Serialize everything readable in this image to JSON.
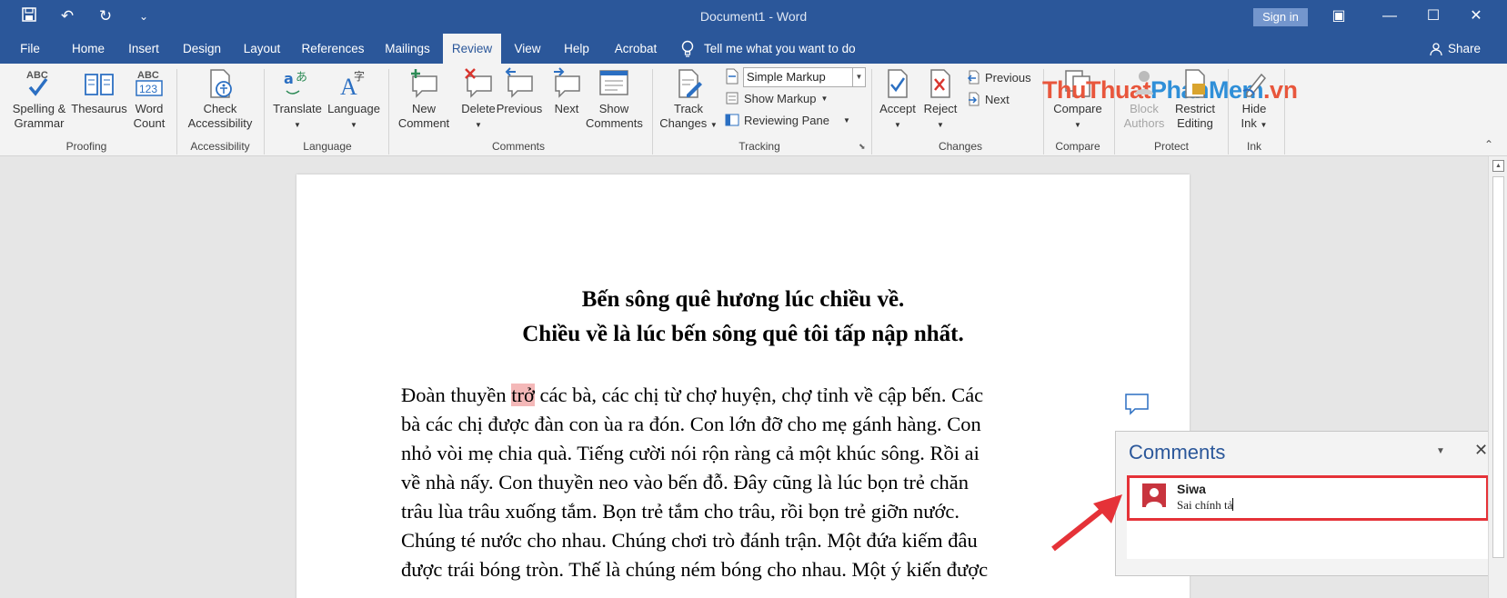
{
  "window": {
    "title": "Document1  -  Word",
    "sign_in": "Sign in",
    "restore_ribbon": "▣",
    "minimize": "—",
    "maximize": "☐",
    "close": "✕"
  },
  "qat": {
    "save": "💾",
    "undo": "↶",
    "redo": "↻",
    "customize": "⌄"
  },
  "tabs": [
    {
      "label": "File"
    },
    {
      "label": "Home"
    },
    {
      "label": "Insert"
    },
    {
      "label": "Design"
    },
    {
      "label": "Layout"
    },
    {
      "label": "References"
    },
    {
      "label": "Mailings"
    },
    {
      "label": "Review"
    },
    {
      "label": "View"
    },
    {
      "label": "Help"
    },
    {
      "label": "Acrobat"
    }
  ],
  "tell_me": "Tell me what you want to do",
  "share": "Share",
  "ribbon": {
    "proofing": {
      "spelling": [
        "Spelling &",
        "Grammar"
      ],
      "thesaurus": "Thesaurus",
      "word_count": [
        "Word",
        "Count"
      ],
      "label": "Proofing"
    },
    "accessibility": {
      "check": [
        "Check",
        "Accessibility"
      ],
      "label": "Accessibility"
    },
    "language": {
      "translate": "Translate",
      "language": "Language",
      "label": "Language"
    },
    "comments": {
      "new": [
        "New",
        "Comment"
      ],
      "delete": "Delete",
      "previous": "Previous",
      "next": "Next",
      "show": [
        "Show",
        "Comments"
      ],
      "label": "Comments"
    },
    "tracking": {
      "track_changes": [
        "Track",
        "Changes"
      ],
      "markup_select": "Simple Markup",
      "show_markup": "Show Markup",
      "reviewing_pane": "Reviewing Pane",
      "label": "Tracking"
    },
    "changes": {
      "accept": "Accept",
      "reject": "Reject",
      "previous": "Previous",
      "next": "Next",
      "label": "Changes"
    },
    "compare": {
      "compare": "Compare",
      "label": "Compare"
    },
    "protect": {
      "block_authors": [
        "Block",
        "Authors"
      ],
      "restrict_editing": [
        "Restrict",
        "Editing"
      ],
      "label": "Protect"
    },
    "ink": {
      "hide_ink": [
        "Hide",
        "Ink"
      ],
      "label": "Ink"
    },
    "watermark": {
      "part1": "ThuThuat",
      "part2": "PhanMem",
      "part3": ".vn"
    }
  },
  "document": {
    "heading1": "Bến sông quê hương lúc chiều về.",
    "heading2": "Chiều về là lúc bến sông quê tôi tấp nập nhất.",
    "lines": [
      {
        "before": "Đoàn thuyền ",
        "highlight": "trở",
        "after": " các bà, các chị từ chợ huyện, chợ tỉnh về cập bến. Các"
      },
      {
        "text": "bà các chị được đàn con ùa ra đón. Con lớn đỡ cho mẹ gánh hàng. Con"
      },
      {
        "text": "nhỏ vòi mẹ chia quà. Tiếng cười nói rộn ràng cả một khúc sông. Rồi ai"
      },
      {
        "text": "về nhà nấy. Con thuyền neo vào bến đỗ. Đây cũng là lúc bọn trẻ chăn"
      },
      {
        "text": "trâu lùa trâu xuống tắm. Bọn trẻ tắm cho trâu, rồi bọn trẻ giỡn nước."
      },
      {
        "text": "Chúng té nước cho nhau. Chúng chơi trò đánh trận. Một đứa kiếm đâu"
      },
      {
        "text": "được trái bóng tròn. Thế là chúng ném bóng cho nhau. Một ý kiến được"
      }
    ]
  },
  "comments_pane": {
    "title": "Comments",
    "author": "Siwa",
    "text": "Sai chính tả"
  },
  "colors": {
    "word_blue": "#2b579a",
    "highlight": "#f4b8b8",
    "callout_red": "#e53238"
  }
}
